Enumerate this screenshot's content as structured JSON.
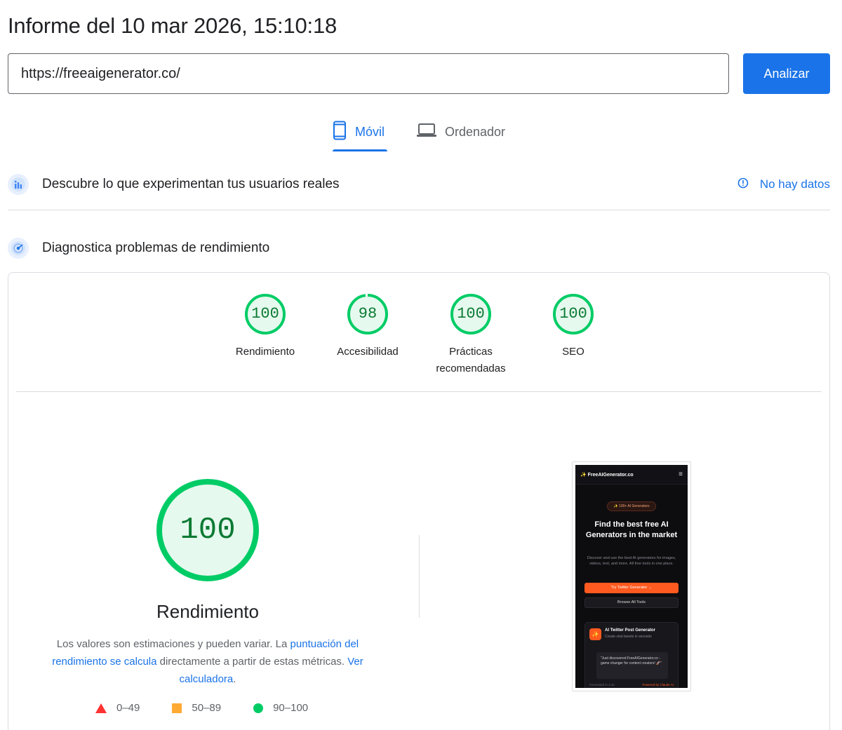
{
  "report": {
    "title": "Informe del 10 mar 2026, 15:10:18"
  },
  "search": {
    "url": "https://freeaigenerator.co/",
    "analyze_label": "Analizar"
  },
  "tabs": [
    {
      "label": "Móvil",
      "icon": "smartphone-icon",
      "selected": true
    },
    {
      "label": "Ordenador",
      "icon": "laptop-icon",
      "selected": false
    }
  ],
  "crux": {
    "title": "Descubre lo que experimentan tus usuarios reales",
    "icon": "users-chart-icon",
    "no_data_label": "No hay datos",
    "no_data_icon": "info-icon"
  },
  "diagnostics": {
    "title": "Diagnostica problemas de rendimiento",
    "icon": "lighthouse-icon"
  },
  "scores": [
    {
      "value": "100",
      "label": "Rendimiento",
      "fraction": 1.0
    },
    {
      "value": "98",
      "label": "Accesibilidad",
      "fraction": 0.98
    },
    {
      "value": "100",
      "label": "Prácticas recomendadas",
      "fraction": 1.0
    },
    {
      "value": "100",
      "label": "SEO",
      "fraction": 1.0
    }
  ],
  "performance": {
    "score": "100",
    "fraction": 1.0,
    "label": "Rendimiento",
    "desc_part1": "Los valores son estimaciones y pueden variar. La ",
    "desc_link1": "puntuación del rendimiento se calcula",
    "desc_part2": " directamente a partir de estas métricas. ",
    "desc_link2": "Ver calculadora",
    "desc_part3": "."
  },
  "legend": {
    "fail": "0–49",
    "average": "50–89",
    "pass": "90–100"
  },
  "screenshot": {
    "brand": "✨ FreeAIGenerator.co",
    "menu_icon": "≡",
    "badge": "✨ 100+ AI Generators",
    "headline": "Find the best free AI Generators in the market",
    "paragraph": "Discover and use the best AI generators for images, videos, text, and more. All free tools in one place.",
    "primary_button": "Try Twitter Generator →",
    "secondary_button": "Browse All Tools",
    "card_icon": "✨",
    "card_title": "AI Twitter Post Generator",
    "card_subtitle": "Create viral tweets in seconds",
    "card_quote": "\"Just discovered FreeAIGenerator.co - game changer for content creators! 🚀\"",
    "card_footer_left": "Generated in 2.3s",
    "card_footer_right": "Powered by Claude AI"
  },
  "colors": {
    "accent": "#1a73e8",
    "pass": "#0c6",
    "pass_text": "#0c7a34",
    "pass_bg": "#e6f9ee",
    "average": "#fa3",
    "fail": "#f33"
  }
}
